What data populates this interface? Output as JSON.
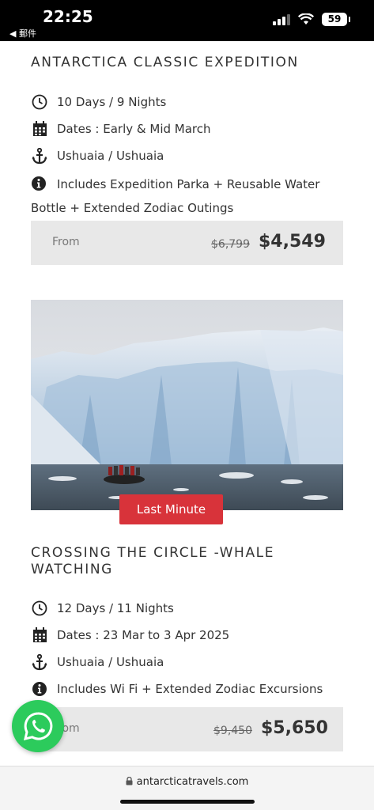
{
  "status_bar": {
    "time": "22:25",
    "back_label": "◀ 郵件",
    "battery": "59"
  },
  "tour1": {
    "title": "ANTARCTICA CLASSIC EXPEDITION",
    "duration": "10 Days / 9 Nights",
    "dates": "Dates : Early & Mid March",
    "route": "Ushuaia / Ushuaia",
    "includes": "Includes Expedition Parka + Reusable Water Bottle + Extended Zodiac Outings",
    "price_from": "From",
    "old_price": "$6,799",
    "new_price": "$4,549"
  },
  "tour2": {
    "badge": "Last Minute",
    "title_line1": "CROSSING THE CIRCLE -WHALE",
    "title_line2": "WATCHING",
    "duration": "12 Days / 11 Nights",
    "dates": "Dates : 23 Mar to 3 Apr 2025",
    "route": "Ushuaia / Ushuaia",
    "includes": "Includes Wi Fi + Extended Zodiac Excursions",
    "price_from": "From",
    "old_price": "$9,450",
    "new_price": "$5,650"
  },
  "browser": {
    "url": "antarcticatravels.com"
  },
  "icons": {
    "clock": "clock-icon",
    "calendar": "calendar-icon",
    "anchor": "anchor-icon",
    "info": "info-icon",
    "whatsapp": "whatsapp-icon",
    "lock": "lock-icon",
    "wifi": "wifi-icon",
    "signal": "signal-icon",
    "battery": "battery-icon"
  },
  "colors": {
    "badge": "#d8333a",
    "whatsapp": "#2ccb5c",
    "price_box": "#e8e8e8"
  }
}
